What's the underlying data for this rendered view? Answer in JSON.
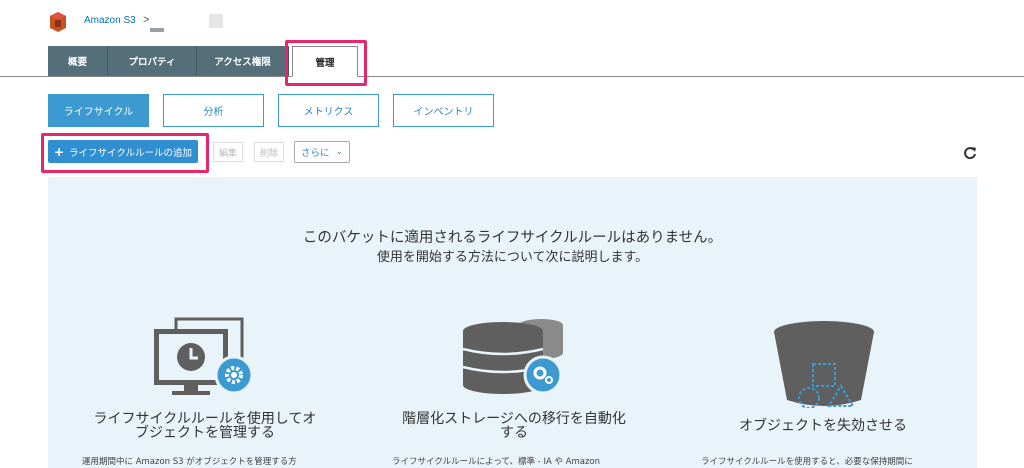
{
  "breadcrumb": {
    "root": "Amazon S3",
    "sep": ">"
  },
  "tabs": [
    {
      "label": "概要"
    },
    {
      "label": "プロパティ"
    },
    {
      "label": "アクセス権限"
    },
    {
      "label": "管理"
    }
  ],
  "subtabs": [
    {
      "label": "ライフサイクル"
    },
    {
      "label": "分析"
    },
    {
      "label": "メトリクス"
    },
    {
      "label": "インベントリ"
    }
  ],
  "toolbar": {
    "add_label": "ライフサイクルルールの追加",
    "add_icon": "+",
    "edit_label": "編集",
    "delete_label": "削除",
    "more_label": "さらに",
    "more_icon": "⌄"
  },
  "empty_state": {
    "line1": "このバケットに適用されるライフサイクルルールはありません。",
    "line2": "使用を開始する方法について次に説明します。"
  },
  "cards": [
    {
      "icon": "clock-monitor-gear-icon",
      "title_l1": "ライフサイクルルールを使用してオ",
      "title_l2": "ブジェクトを管理する",
      "body": "運用期間中に Amazon S3 がオブジェクトを管理する方"
    },
    {
      "icon": "database-gear-icon",
      "title_l1": "階層化ストレージへの移行を自動化",
      "title_l2": "する",
      "body": "ライフサイクルルールによって、標準 - IA や Amazon"
    },
    {
      "icon": "bucket-icon",
      "title_l1": "オブジェクトを失効させる",
      "title_l2": "",
      "body": "ライフサイクルルールを使用すると、必要な保持期間に"
    }
  ],
  "colors": {
    "tab_bg": "#546e7a",
    "accent_blue": "#3d9ad1",
    "highlight": "#e8266b",
    "panel_bg": "#e9f3fa",
    "icon_gray": "#5f5f5f",
    "gear_blue": "#3d9ad1"
  }
}
